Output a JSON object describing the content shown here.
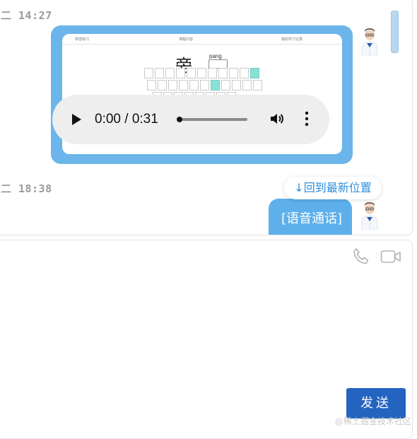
{
  "history": {
    "messages": [
      {
        "time": "二 14:27",
        "type": "media",
        "keyboard": {
          "header_left": "拼音练习",
          "header_mid": "课程内容",
          "header_right": "我的学习记录",
          "character": "旁",
          "pinyin": "pang"
        },
        "audio": {
          "time_display": "0:00 / 0:31",
          "progress": 0.0
        },
        "avatar": "doctor-avatar"
      },
      {
        "time": "二 18:38",
        "type": "text",
        "text": "[语音通话]",
        "avatar": "doctor-avatar"
      }
    ],
    "jump_latest_label": "↓回到最新位置"
  },
  "composer": {
    "icons": [
      "phone-icon",
      "video-icon"
    ],
    "send_label": "发送"
  },
  "watermark": "@稀土掘金技术社区",
  "colors": {
    "bubble": "#6bb5ea",
    "send": "#2464c1",
    "link": "#2e8fdd",
    "highlight_key": "#8be0d6"
  }
}
